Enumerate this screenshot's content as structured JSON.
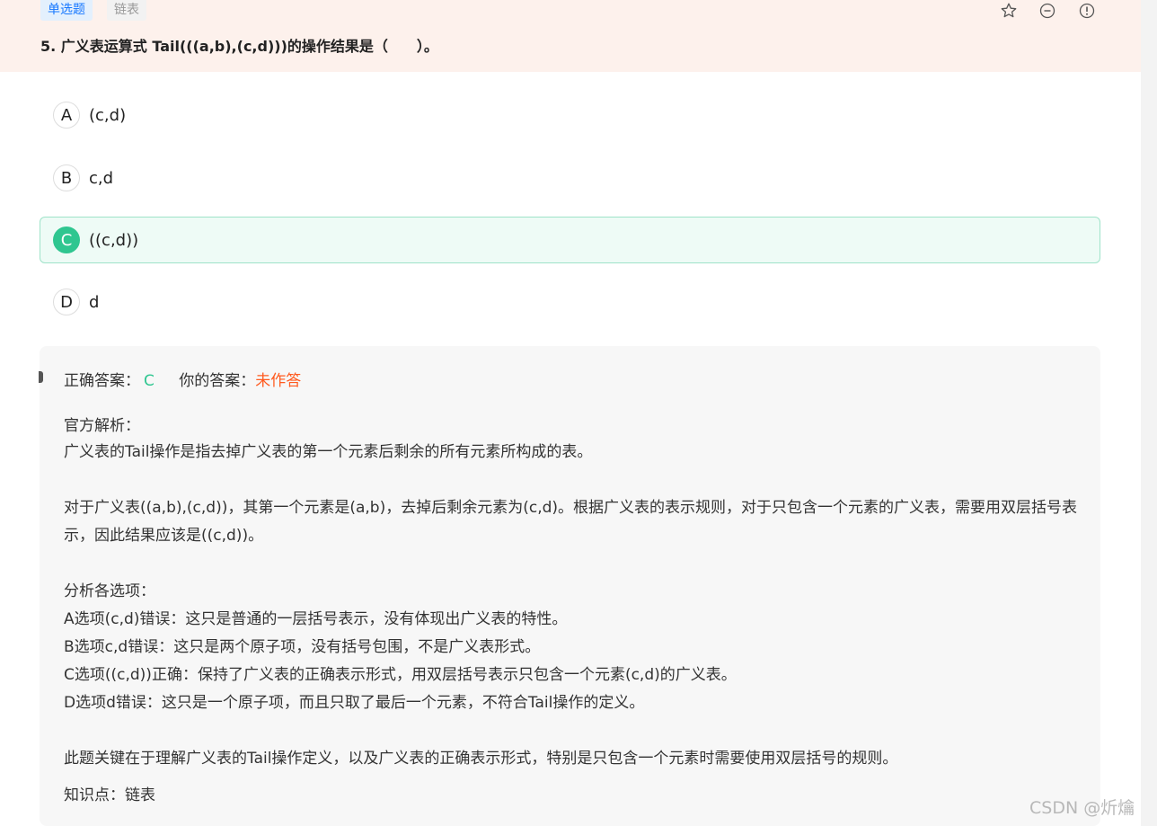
{
  "header": {
    "tag_type": "单选题",
    "tag_knowledge": "链表",
    "question_title": "5. 广义表运算式 Tail(((a,b),(c,d)))的操作结果是（　　）。",
    "icons": [
      "star-icon",
      "minus-circle-icon",
      "exclamation-circle-icon"
    ]
  },
  "options": [
    {
      "key": "A",
      "text": "(c,d)"
    },
    {
      "key": "B",
      "text": "c,d"
    },
    {
      "key": "C",
      "text": "((c,d))"
    },
    {
      "key": "D",
      "text": "d"
    }
  ],
  "analysis": {
    "correct_label": "正确答案：",
    "correct_value": "C",
    "yours_label": "你的答案：",
    "yours_value": "未作答",
    "official_title": "官方解析：",
    "paragraphs": [
      "广义表的Tail操作是指去掉广义表的第一个元素后剩余的所有元素所构成的表。",
      "对于广义表((a,b),(c,d))，其第一个元素是(a,b)，去掉后剩余元素为(c,d)。根据广义表的表示规则，对于只包含一个元素的广义表，需要用双层括号表示，因此结果应该是((c,d))。",
      "分析各选项：",
      "A选项(c,d)错误：这只是普通的一层括号表示，没有体现出广义表的特性。",
      "B选项c,d错误：这只是两个原子项，没有括号包围，不是广义表形式。",
      "C选项((c,d))正确：保持了广义表的正确表示形式，用双层括号表示只包含一个元素(c,d)的广义表。",
      "D选项d错误：这只是一个原子项，而且只取了最后一个元素，不符合Tail操作的定义。",
      "此题关键在于理解广义表的Tail操作定义，以及广义表的正确表示形式，特别是只包含一个元素时需要使用双层括号的规则。"
    ],
    "knowledge_point": "知识点：链表"
  },
  "watermark": "CSDN @炘爚",
  "colors": {
    "correct": "#2fc690",
    "unanswered": "#ff5a1f",
    "header_bg": "#fdf1ec",
    "tag_blue": "#1677ff"
  }
}
